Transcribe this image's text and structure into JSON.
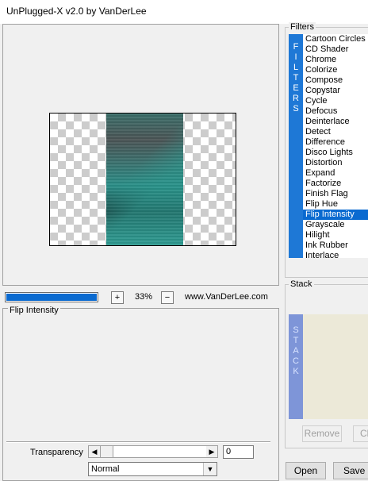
{
  "window": {
    "title": "UnPlugged-X v2.0 by VanDerLee"
  },
  "toolbar": {
    "progress_percent": 100,
    "zoom_in_label": "+",
    "zoom_value": "33%",
    "zoom_out_label": "−",
    "website": "www.VanDerLee.com"
  },
  "params": {
    "title": "Flip Intensity",
    "transparency_label": "Transparency",
    "transparency_value": "0",
    "blend_mode": "Normal"
  },
  "filters": {
    "title": "Filters",
    "strip_letters": [
      "F",
      "I",
      "L",
      "T",
      "E",
      "R",
      "S"
    ],
    "items": [
      "Cartoon Circles",
      "CD Shader",
      "Chrome",
      "Colorize",
      "Compose",
      "Copystar",
      "Cycle",
      "Defocus",
      "Deinterlace",
      "Detect",
      "Difference",
      "Disco Lights",
      "Distortion",
      "Expand",
      "Factorize",
      "Finish Flag",
      "Flip Hue",
      "Flip Intensity",
      "Grayscale",
      "Hilight",
      "Ink Rubber",
      "Interlace"
    ],
    "selected": "Flip Intensity"
  },
  "stack": {
    "title": "Stack",
    "strip_letters": [
      "S",
      "T",
      "A",
      "C",
      "K"
    ],
    "remove_label": "Remove",
    "clear_label": "Cl"
  },
  "footer": {
    "open_label": "Open",
    "save_label": "Save"
  },
  "colors": {
    "accent": "#0a6ad0",
    "filters_strip": "#1e78d6",
    "stack_strip": "#7e95d8"
  }
}
